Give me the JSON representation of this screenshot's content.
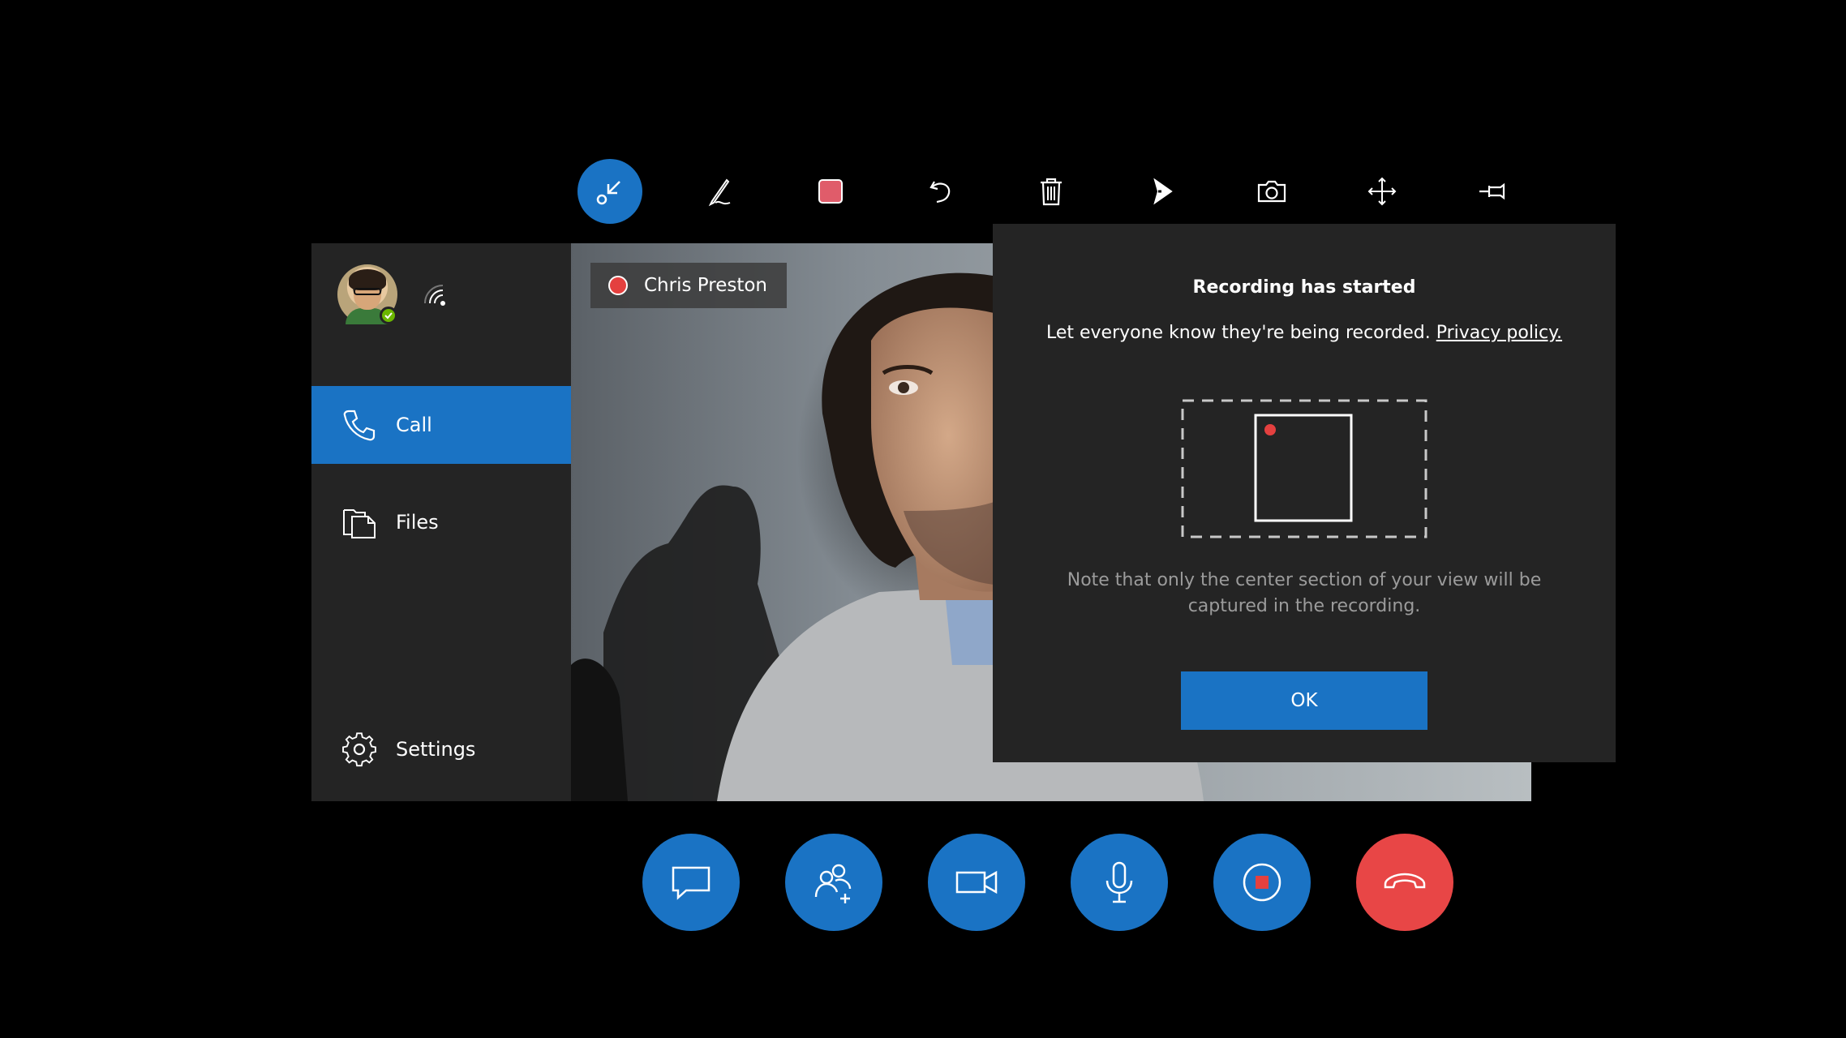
{
  "toolbar": {
    "tools": [
      {
        "icon": "minimize-arrow-icon",
        "active": true
      },
      {
        "icon": "ink-pen-icon",
        "active": false
      },
      {
        "icon": "ink-color-swatch-icon",
        "swatch_color": "#e05c6a",
        "active": false
      },
      {
        "icon": "undo-icon",
        "active": false
      },
      {
        "icon": "trash-icon",
        "active": false
      },
      {
        "icon": "pointer-arrow-icon",
        "active": false
      },
      {
        "icon": "camera-icon",
        "active": false
      },
      {
        "icon": "move-icon",
        "active": false
      },
      {
        "icon": "pin-icon",
        "active": false
      }
    ]
  },
  "sidebar": {
    "presence_status": "available",
    "items": [
      {
        "label": "Call",
        "icon": "phone-icon",
        "active": true
      },
      {
        "label": "Files",
        "icon": "files-icon",
        "active": false
      },
      {
        "label": "Settings",
        "icon": "gear-icon",
        "active": false
      }
    ]
  },
  "video": {
    "participant_name": "Chris Preston"
  },
  "dialog": {
    "title": "Recording has started",
    "body": "Let everyone know they're being recorded.",
    "link": "Privacy policy.",
    "note": "Note that only the center section of your view will be captured in the recording.",
    "ok_label": "OK"
  },
  "controls": [
    {
      "icon": "chat-icon"
    },
    {
      "icon": "add-people-icon"
    },
    {
      "icon": "video-camera-icon"
    },
    {
      "icon": "microphone-icon"
    },
    {
      "icon": "stop-recording-icon"
    },
    {
      "icon": "hang-up-icon"
    }
  ],
  "colors": {
    "accent": "#1a73c4",
    "recording_red": "#e4403f",
    "hangup_red": "#e84646",
    "panel_bg": "#242424",
    "presence_green": "#6bb700"
  }
}
